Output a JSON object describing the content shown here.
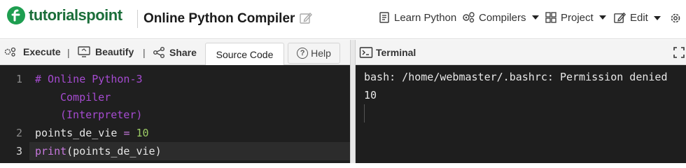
{
  "header": {
    "brand": "tutorialspoint",
    "page_title": "Online Python Compiler",
    "nav": {
      "learn": "Learn Python",
      "compilers": "Compilers",
      "project": "Project",
      "edit": "Edit"
    }
  },
  "toolbar": {
    "execute": "Execute",
    "beautify": "Beautify",
    "share": "Share",
    "separator": "|",
    "source_tab": "Source Code",
    "help_tab": "Help"
  },
  "editor": {
    "line_numbers": [
      "1",
      "2",
      "3"
    ],
    "comment_l1": "# Online Python-3",
    "comment_l2": "Compiler",
    "comment_l3": "(Interpreter)",
    "line2_var": "points_de_vie",
    "line2_op": "=",
    "line2_num": "10",
    "line3_fn": "print",
    "line3_args": "(points_de_vie)"
  },
  "terminal": {
    "label": "Terminal",
    "lines": [
      "bash: /home/webmaster/.bashrc: Permission denied",
      "10"
    ]
  },
  "colors": {
    "brand_green": "#1e9e50",
    "editor_bg": "#1f1f1f",
    "comment": "#a64bd1",
    "number": "#9ccc65"
  }
}
